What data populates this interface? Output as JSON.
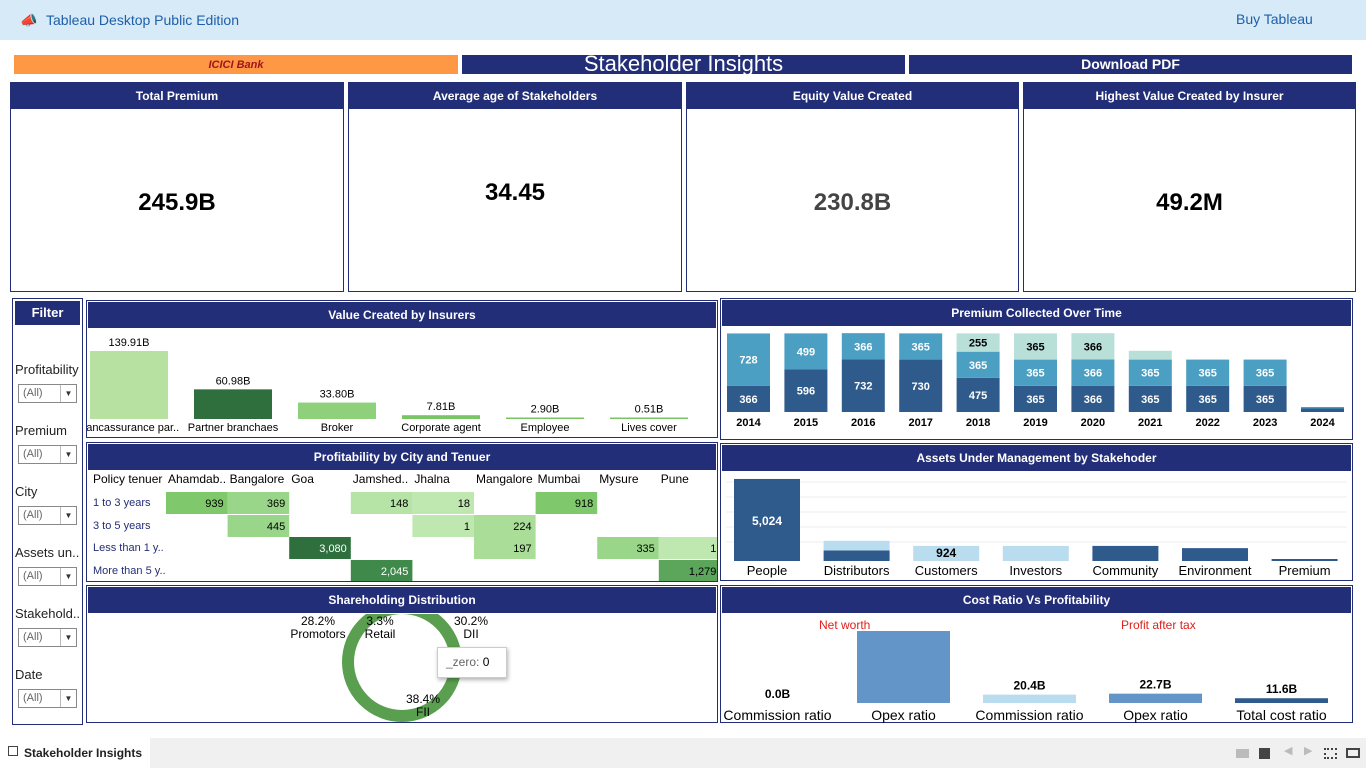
{
  "app": {
    "title": "Tableau Desktop Public Edition",
    "buy": "Buy Tableau"
  },
  "header": {
    "logo": "ICICI Bank",
    "title": "Stakeholder Insights",
    "download": "Download PDF"
  },
  "kpis": [
    {
      "label": "Total Premium",
      "value": "245.9B"
    },
    {
      "label": "Average age of Stakeholders",
      "value": "34.45"
    },
    {
      "label": "Equity Value Created",
      "value": "230.8B"
    },
    {
      "label": "Highest Value Created by Insurer",
      "value": "49.2M"
    }
  ],
  "filters": {
    "title": "Filter",
    "items": [
      {
        "label": "Profitability",
        "value": "(All)"
      },
      {
        "label": "Premium",
        "value": "(All)"
      },
      {
        "label": "City",
        "value": "(All)"
      },
      {
        "label": "Assets un..",
        "value": "(All)"
      },
      {
        "label": "Stakehold..",
        "value": "(All)"
      },
      {
        "label": "Date",
        "value": "(All)"
      }
    ]
  },
  "value_created": {
    "title": "Value Created by  Insurers"
  },
  "premium_time": {
    "title": "Premium Collected Over Time"
  },
  "heatmap_title": "Profitability by City and Tenuer",
  "aum": {
    "title": "Assets Under Management by Stakehoder"
  },
  "shareholding": {
    "title": "Shareholding Distribution",
    "tooltip_label": "_zero:",
    "tooltip_value": "0"
  },
  "cost_ratio": {
    "title": "Cost Ratio Vs Profitability",
    "group1": "Net worth",
    "group2": "Profit after tax"
  },
  "bottom": {
    "sheet_tab": "Stakeholder Insights"
  },
  "colors": {
    "navy": "#232e78",
    "orange": "#ff9845",
    "accent": "#1f5fa8"
  },
  "chart_data": [
    {
      "type": "bar",
      "title": "Value Created by  Insurers",
      "categories": [
        "Bancassurance par..",
        "Partner branchaes",
        "Broker",
        "Corporate agent",
        "Employee",
        "Lives cover"
      ],
      "values": [
        139.91,
        60.98,
        33.8,
        7.81,
        2.9,
        0.51
      ],
      "labels": [
        "139.91B",
        "60.98B",
        "33.80B",
        "7.81B",
        "2.90B",
        "0.51B"
      ],
      "colors": [
        "#b7e1a1",
        "#2f6f3e",
        "#8fd07a",
        "#79c463",
        "#79c463",
        "#79c463"
      ]
    },
    {
      "type": "bar",
      "title": "Premium Collected Over Time",
      "stacked": true,
      "categories": [
        "2014",
        "2015",
        "2016",
        "2017",
        "2018",
        "2019",
        "2020",
        "2021",
        "2022",
        "2023",
        "2024"
      ],
      "series": [
        {
          "values": [
            366,
            596,
            732,
            730,
            475,
            365,
            366,
            365,
            365,
            365,
            0
          ],
          "labels": [
            "366",
            "596",
            "732",
            "730",
            "475",
            "365",
            "366",
            "365",
            "365",
            "365",
            ""
          ],
          "color": "#2e5b8c"
        },
        {
          "values": [
            728,
            499,
            366,
            365,
            365,
            365,
            366,
            365,
            365,
            365,
            0
          ],
          "labels": [
            "728",
            "499",
            "366",
            "365",
            "365",
            "365",
            "366",
            "365",
            "365",
            "365",
            ""
          ],
          "color": "#4b9fc2"
        },
        {
          "values": [
            0,
            0,
            0,
            0,
            255,
            365,
            366,
            123,
            0,
            0,
            0
          ],
          "labels": [
            "",
            "",
            "",
            "",
            "255",
            "365",
            "366",
            "",
            "",
            "",
            ""
          ],
          "color": "#b8e0d9"
        }
      ]
    },
    {
      "type": "heatmap",
      "title": "Profitability by City and Tenuer",
      "row_header": "Policy tenuer",
      "columns": [
        "Ahamdab..",
        "Bangalore",
        "Goa",
        "Jamshed..",
        "Jhalna",
        "Mangalore",
        "Mumbai",
        "Mysure",
        "Pune"
      ],
      "rows": [
        "1 to 3 years",
        "3 to 5 years",
        "Less than 1 y..",
        "More than 5 y.."
      ],
      "cells": [
        {
          "row": 0,
          "col": 0,
          "value": 939,
          "label": "939",
          "color": "#7fc86b"
        },
        {
          "row": 0,
          "col": 1,
          "value": 369,
          "label": "369",
          "color": "#9ad68a"
        },
        {
          "row": 0,
          "col": 3,
          "value": 148,
          "label": "148",
          "color": "#b6e3a6"
        },
        {
          "row": 0,
          "col": 4,
          "value": 18,
          "label": "18",
          "color": "#bfe8b0"
        },
        {
          "row": 0,
          "col": 6,
          "value": 918,
          "label": "918",
          "color": "#7fc86b"
        },
        {
          "row": 1,
          "col": 1,
          "value": 445,
          "label": "445",
          "color": "#9ad68a"
        },
        {
          "row": 1,
          "col": 4,
          "value": 1,
          "label": "1",
          "color": "#bfe8b0"
        },
        {
          "row": 1,
          "col": 5,
          "value": 224,
          "label": "224",
          "color": "#a9dd98"
        },
        {
          "row": 2,
          "col": 2,
          "value": 3080,
          "label": "3,080",
          "color": "#2f6f3e"
        },
        {
          "row": 2,
          "col": 5,
          "value": 197,
          "label": "197",
          "color": "#a9dd98"
        },
        {
          "row": 2,
          "col": 7,
          "value": 335,
          "label": "335",
          "color": "#9ad68a"
        },
        {
          "row": 2,
          "col": 8,
          "value": 1,
          "label": "1",
          "color": "#bfe8b0"
        },
        {
          "row": 3,
          "col": 3,
          "value": 2045,
          "label": "2,045",
          "color": "#3f8a4a"
        },
        {
          "row": 3,
          "col": 8,
          "value": 1279,
          "label": "1,279",
          "color": "#5ba65a"
        }
      ]
    },
    {
      "type": "bar",
      "title": "Assets Under Management by Stakehoder",
      "categories": [
        "People",
        "Distributors",
        "Customers",
        "Investors",
        "Community",
        "Environment",
        "Premium"
      ],
      "series": [
        {
          "values": [
            5024,
            645,
            0,
            0,
            924,
            788,
            52
          ],
          "color": "#2e5b8c"
        },
        {
          "values": [
            0,
            593,
            924,
            924,
            0,
            0,
            0
          ],
          "color": "#b9dcef"
        }
      ],
      "labels": [
        "5,024",
        "",
        "924",
        "",
        "",
        "",
        ""
      ]
    },
    {
      "type": "pie",
      "title": "Shareholding Distribution",
      "slices": [
        {
          "name": "Promotors",
          "pct": 28.2
        },
        {
          "name": "Retail",
          "pct": 3.3
        },
        {
          "name": "DII",
          "pct": 30.2
        },
        {
          "name": "FII",
          "pct": 38.4
        }
      ]
    },
    {
      "type": "bar",
      "title": "Cost Ratio Vs Profitability",
      "groups": [
        "Net worth",
        "Profit after tax"
      ],
      "categories": [
        "Commission ratio",
        "Opex ratio",
        "Commission ratio",
        "Opex ratio",
        "Total cost ratio"
      ],
      "values": [
        0.0,
        191.2,
        20.4,
        22.7,
        11.6
      ],
      "labels": [
        "0.0B",
        "191.2B",
        "20.4B",
        "22.7B",
        "11.6B"
      ],
      "colors": [
        "#6495c8",
        "#6495c8",
        "#b9dcef",
        "#6495c8",
        "#2e5b8c"
      ]
    }
  ]
}
